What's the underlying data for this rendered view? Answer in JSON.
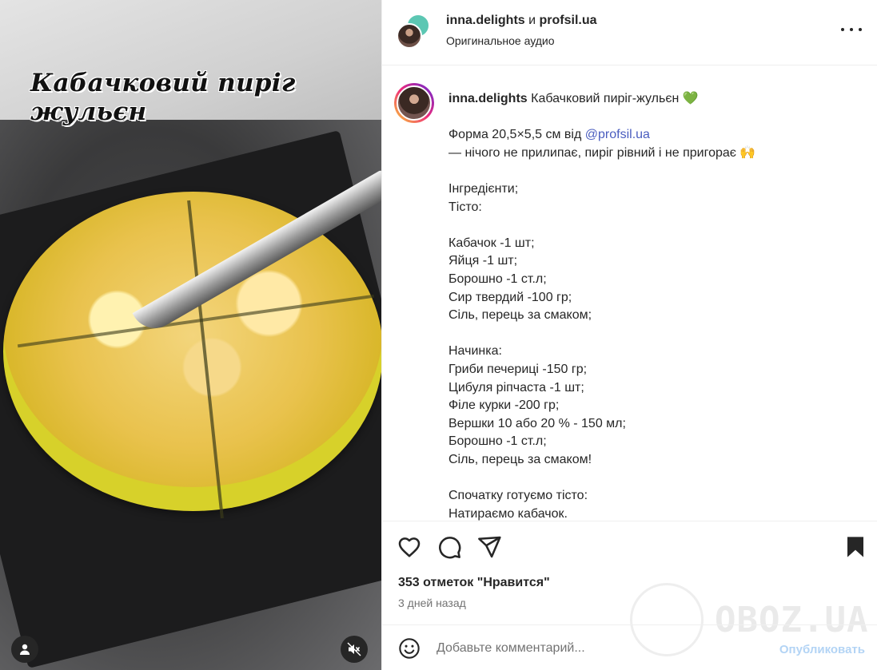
{
  "media": {
    "overlay_caption": "Кабачковий пиріг жульєн",
    "user_icon": "person-icon",
    "mute_icon": "speaker-muted-icon"
  },
  "header": {
    "author_primary": "inna.delights",
    "and_word": " и ",
    "author_secondary": "profsil.ua",
    "audio": "Оригинальное аудио",
    "more_icon": "more-horizontal-icon"
  },
  "caption": {
    "username": "inna.delights",
    "title": " Кабачковий пиріг-жульєн ",
    "title_emoji": "💚",
    "form_prefix": "Форма 20,5×5,5 см від ",
    "form_mention": "@profsil.ua",
    "lines": [
      "— нічого не прилипає, пиріг рівний і не пригорає 🙌",
      "",
      "Інгредієнти;",
      "Тісто:",
      "",
      "Кабачок -1 шт;",
      "Яйця -1 шт;",
      "Борошно -1 ст.л;",
      "Сир твердий -100 гр;",
      "Сіль, перець за смаком;",
      "",
      "Начинка:",
      "Гриби печериці -150 гр;",
      "Цибуля ріпчаста -1 шт;",
      "Філе курки -200 гр;",
      "Вершки 10 або 20 % - 150 мл;",
      "Борошно -1 ст.л;",
      "Сіль, перець за смаком!",
      "",
      "Спочатку готуємо тісто:",
      "Натираємо кабачок."
    ]
  },
  "actions": {
    "likes": "353 отметок \"Нравится\"",
    "time": "3 дней назад"
  },
  "watermark": "OBOZ.UA",
  "comment": {
    "placeholder": "Добавьте комментарий...",
    "publish": "Опубликовать"
  },
  "colors": {
    "mention": "#4a5dbf",
    "publish_disabled": "#b3d4f5",
    "muted_text": "#737373"
  }
}
